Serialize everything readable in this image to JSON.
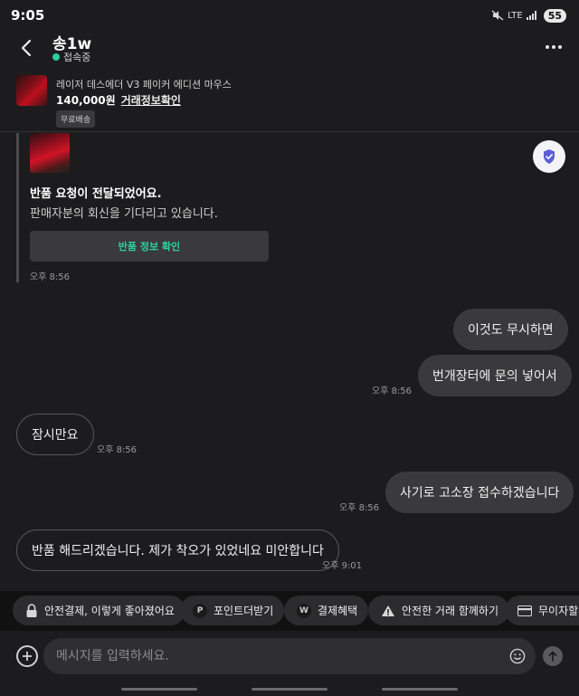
{
  "status": {
    "time": "9:05",
    "network": "LTE",
    "battery": "55"
  },
  "header": {
    "title": "송1w",
    "presence": "접속중"
  },
  "product": {
    "name": "레이저 데스에더 V3 페이커 에디션 마우스",
    "price": "140,000원",
    "link": "거래정보확인",
    "badge": "무료배송"
  },
  "system_card": {
    "title": "반품 요청이 전달되었어요.",
    "subtitle": "판매자분의 회신을 기다리고 있습니다.",
    "button": "반품 정보 확인",
    "time": "오후 8:56"
  },
  "messages": [
    {
      "text": "이것도 무시하면",
      "direction": "outgoing"
    },
    {
      "text": "번개장터에 문의 넣어서",
      "direction": "outgoing",
      "time": "오후 8:56"
    },
    {
      "text": "잠시만요",
      "direction": "incoming",
      "time": "오후 8:56"
    },
    {
      "text": "사기로 고소장 접수하겠습니다",
      "direction": "outgoing",
      "time": "오후 8:56"
    },
    {
      "text": "반품 해드리겠습니다. 제가 착오가 있었네요 미안합니다",
      "direction": "incoming",
      "time": "오후 9:01"
    }
  ],
  "quick_actions": [
    {
      "label": "안전결제, 이렇게 좋아졌어요",
      "icon": "lock-icon"
    },
    {
      "label": "포인트더받기",
      "icon": "point-icon"
    },
    {
      "label": "결제혜택",
      "icon": "won-icon"
    },
    {
      "label": "안전한 거래 함께하기",
      "icon": "warning-icon"
    },
    {
      "label": "무이자할부",
      "icon": "card-icon"
    }
  ],
  "composer": {
    "placeholder": "메시지를 입력하세요."
  },
  "colors": {
    "accent": "#2fcf9e",
    "background": "#1c1c1e",
    "bubble": "#3a3a3c"
  }
}
